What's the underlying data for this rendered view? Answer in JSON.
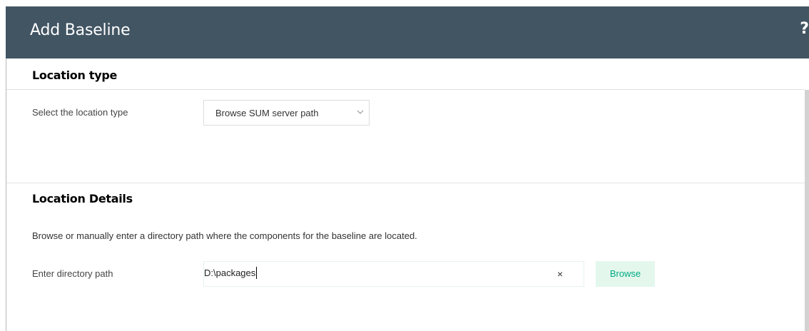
{
  "dialog": {
    "title": "Add Baseline",
    "help_label": "?"
  },
  "location_type": {
    "heading": "Location type",
    "select_label": "Select the location type",
    "select_value": "Browse SUM server path"
  },
  "location_details": {
    "heading": "Location Details",
    "description": "Browse or manually enter a directory path where the components for the baseline are located.",
    "path_label": "Enter directory path",
    "path_value": "D:\\packages",
    "clear_label": "×",
    "browse_label": "Browse"
  },
  "colors": {
    "header_bg": "#425563",
    "accent": "#01a982",
    "browse_bg": "#e3f7ed"
  },
  "icons": {
    "help": "help-icon",
    "dropdown": "chevron-down-icon",
    "clear": "close-icon"
  }
}
